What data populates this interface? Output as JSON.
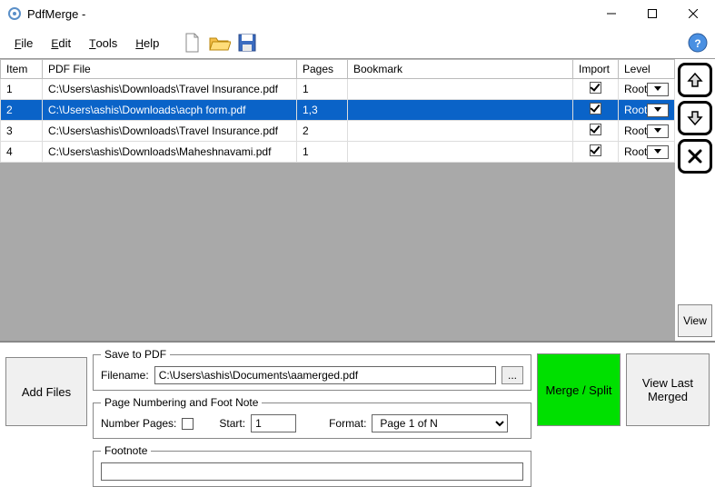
{
  "titlebar": {
    "title": "PdfMerge -"
  },
  "menu": {
    "file": "File",
    "edit": "Edit",
    "tools": "Tools",
    "help": "Help"
  },
  "table": {
    "headers": {
      "item": "Item",
      "pdf": "PDF File",
      "pages": "Pages",
      "bookmark": "Bookmark",
      "import": "Import",
      "level": "Level"
    },
    "rows": [
      {
        "idx": "1",
        "file": "C:\\Users\\ashis\\Downloads\\Travel Insurance.pdf",
        "pages": "1",
        "bookmark": "",
        "import": true,
        "level": "Root",
        "selected": false
      },
      {
        "idx": "2",
        "file": "C:\\Users\\ashis\\Downloads\\acph form.pdf",
        "pages": "1,3",
        "bookmark": "",
        "import": true,
        "level": "Root",
        "selected": true
      },
      {
        "idx": "3",
        "file": "C:\\Users\\ashis\\Downloads\\Travel Insurance.pdf",
        "pages": "2",
        "bookmark": "",
        "import": true,
        "level": "Root",
        "selected": false
      },
      {
        "idx": "4",
        "file": "C:\\Users\\ashis\\Downloads\\Maheshnavami.pdf",
        "pages": "1",
        "bookmark": "",
        "import": true,
        "level": "Root",
        "selected": false
      }
    ]
  },
  "sidebar": {
    "view": "View"
  },
  "bottom": {
    "addfiles": "Add Files",
    "mergesplit": "Merge / Split",
    "viewlast": "View Last Merged",
    "saveto": {
      "legend": "Save to PDF",
      "filename_lbl": "Filename:",
      "filename": "C:\\Users\\ashis\\Documents\\aamerged.pdf",
      "browse": "..."
    },
    "paging": {
      "legend": "Page Numbering and Foot Note",
      "number_lbl": "Number Pages:",
      "start_lbl": "Start:",
      "start": "1",
      "format_lbl": "Format:",
      "format": "Page 1 of N"
    },
    "footnote": {
      "legend": "Footnote",
      "value": ""
    }
  }
}
